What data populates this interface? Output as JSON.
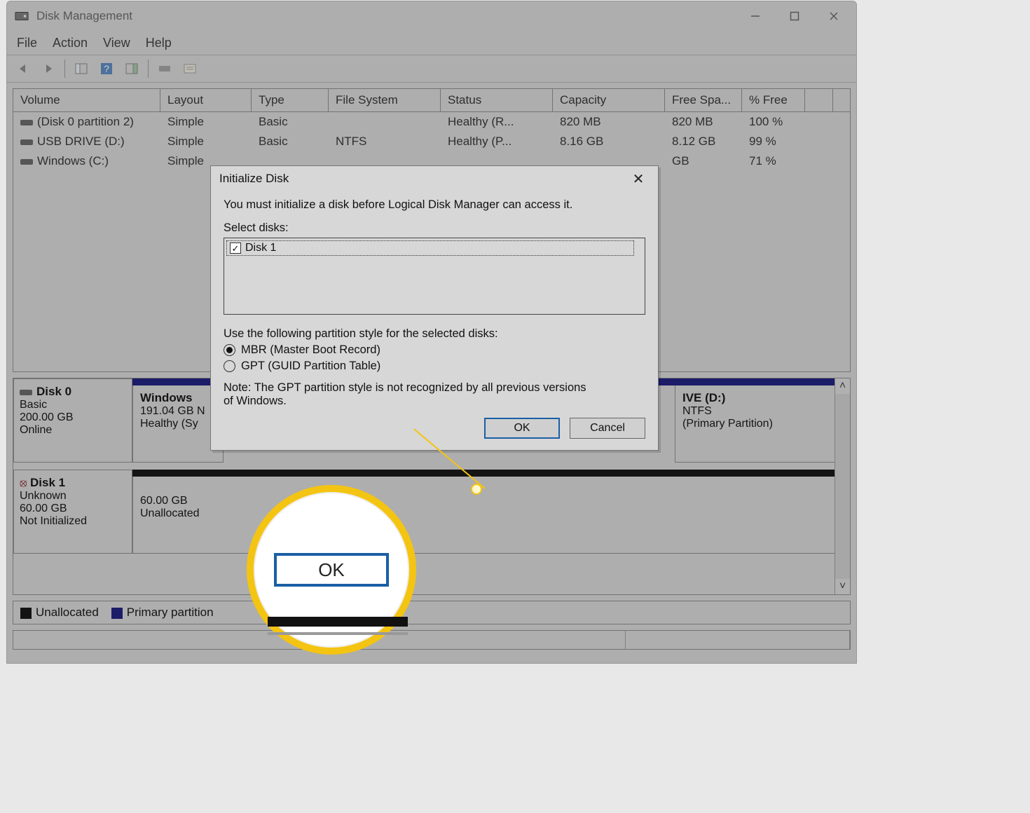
{
  "window": {
    "title": "Disk Management",
    "menus": [
      "File",
      "Action",
      "View",
      "Help"
    ]
  },
  "columns": [
    "Volume",
    "Layout",
    "Type",
    "File System",
    "Status",
    "Capacity",
    "Free Spa...",
    "% Free"
  ],
  "volumes": [
    {
      "name": "(Disk 0 partition 2)",
      "layout": "Simple",
      "type": "Basic",
      "fs": "",
      "status": "Healthy (R...",
      "capacity": "820 MB",
      "free": "820 MB",
      "pct": "100 %"
    },
    {
      "name": "USB DRIVE (D:)",
      "layout": "Simple",
      "type": "Basic",
      "fs": "NTFS",
      "status": "Healthy (P...",
      "capacity": "8.16 GB",
      "free": "8.12 GB",
      "pct": "99 %"
    },
    {
      "name": "Windows (C:)",
      "layout": "Simple",
      "type": "",
      "fs": "",
      "status": "",
      "capacity": "",
      "free": "GB",
      "pct": "71 %"
    }
  ],
  "disks": {
    "disk0": {
      "label": "Disk 0",
      "info": [
        "Basic",
        "200.00 GB",
        "Online"
      ],
      "parts": [
        {
          "title": "Windows",
          "lines": [
            "191.04 GB N",
            "Healthy (Sy"
          ]
        },
        {
          "title": "IVE (D:)",
          "lines": [
            "NTFS",
            "(Primary Partition)"
          ]
        }
      ]
    },
    "disk1": {
      "label": "Disk 1",
      "info": [
        "Unknown",
        "60.00 GB",
        "Not Initialized"
      ],
      "parts": [
        {
          "title": "",
          "lines": [
            "60.00 GB",
            "Unallocated"
          ]
        }
      ]
    }
  },
  "legend": {
    "unallocated": "Unallocated",
    "primary": "Primary partition"
  },
  "dialog": {
    "title": "Initialize Disk",
    "intro": "You must initialize a disk before Logical Disk Manager can access it.",
    "select_label": "Select disks:",
    "disk_item": "Disk 1",
    "style_label": "Use the following partition style for the selected disks:",
    "mbr": "MBR (Master Boot Record)",
    "gpt": "GPT (GUID Partition Table)",
    "note": "Note: The GPT partition style is not recognized by all previous versions of Windows.",
    "ok": "OK",
    "cancel": "Cancel"
  },
  "callout": {
    "ok": "OK"
  }
}
